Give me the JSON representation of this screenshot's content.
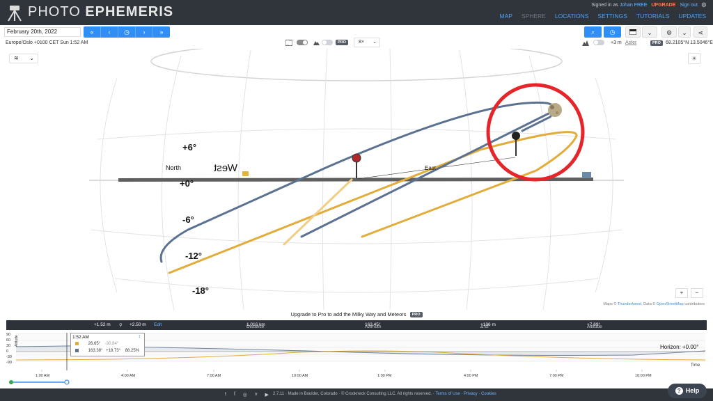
{
  "header": {
    "brand_part1": "PHOTO",
    "brand_part2": "EPHEMERIS",
    "signed_in_prefix": "Signed in as",
    "user": "Johan FREE",
    "upgrade": "UPGRADE",
    "signout": "Sign out",
    "gear_glyph": "⚙",
    "nav": [
      "MAP",
      "SPHERE",
      "LOCATIONS",
      "SETTINGS",
      "TUTORIALS",
      "UPDATES"
    ]
  },
  "toolbar": {
    "date": "February 20th, 2022",
    "time_buttons": [
      "«",
      "‹",
      "◷",
      "›",
      "»"
    ],
    "search_glyph": "⌕",
    "clock_glyph": "◷",
    "more_glyph": "⋮",
    "share_glyph": "⋖",
    "chevron": "⌄"
  },
  "status": {
    "timezone_line": "Europe/Oslo +0100 CET Sun 1:52 AM",
    "pro": "PRO",
    "zoom_select": "8×",
    "offset": "+3 m",
    "aster": "Aster",
    "coords": "68.2105°N 13.5046°E"
  },
  "sphere": {
    "labels": {
      "plus6": "+6°",
      "zero": "+0°",
      "minus6": "-6°",
      "minus12": "-12°",
      "minus18": "-18°",
      "north": "North",
      "west": "West",
      "east": "East"
    },
    "layers_glyph": "≋",
    "bulb_glyph": "☀",
    "zoom_in": "+",
    "zoom_out": "−",
    "colors": {
      "moon_path": "#5b7190",
      "sun_path": "#e2ac3a",
      "highlight": "#e4262a",
      "horizon": "#5a5a5a"
    }
  },
  "attribution": {
    "prefix": "Maps ©",
    "thunderforest": "Thunderforest",
    "data": ", Data ©",
    "osm": "OpenStreetMap",
    "suffix": "contributors"
  },
  "upgrade_line": "Upgrade to Pro to add the Milky Way and Meteors",
  "infobar": {
    "height1": "+1.52 m",
    "height2": "+2.50 m",
    "edit": "Edit",
    "distance_label": "Distance",
    "distance": "1.016 km",
    "azimuth_label": "Azimuth",
    "azimuth": "163.45°",
    "del_label": "Δ El",
    "del": "+136 m",
    "altitude_label": "Altitude",
    "altitude": "+7.69°"
  },
  "timeline": {
    "y_ticks": [
      "90",
      "60",
      "30",
      "0",
      "-30",
      "-90"
    ],
    "altitude_label": "Altitude",
    "time_ticks": [
      "1:00 AM",
      "4:00 AM",
      "7:00 AM",
      "10:00 AM",
      "1:00 PM",
      "4:00 PM",
      "7:00 PM",
      "10:00 PM"
    ],
    "tooltip_time": "1:52 AM",
    "tooltip_pin": "↕",
    "sun_az": "26.65°",
    "sun_alt": "-30.84°",
    "moon_az": "163.38°",
    "moon_alt": "+18.73°",
    "moon_illum": "88.25%",
    "horizon_label": "Horizon: +0.00°",
    "time_axis_label": "Time"
  },
  "footer": {
    "icons": [
      "twitter-icon",
      "facebook-icon",
      "instagram-icon",
      "vimeo-icon",
      "youtube-icon"
    ],
    "icon_glyphs": [
      "t",
      "f",
      "◎",
      "v",
      "▶"
    ],
    "copyright": "2.7.11 · Made in Boulder, Colorado · © Crookneck Consulting LLC. All rights reserved. ·",
    "terms": "Terms of Use",
    "privacy": "Privacy",
    "cookies": "Cookies",
    "sep": "·"
  },
  "help": {
    "q": "?",
    "label": "Help"
  }
}
